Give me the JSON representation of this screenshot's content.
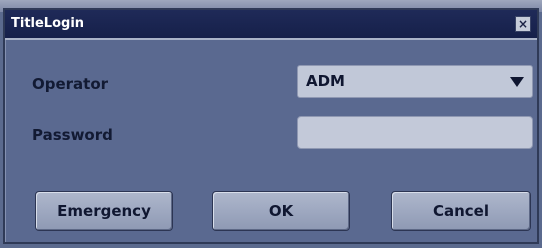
{
  "dialog": {
    "title": "TitleLogin",
    "close_glyph": "×"
  },
  "form": {
    "operator_label": "Operator",
    "operator_value": "ADM",
    "password_label": "Password",
    "password_value": ""
  },
  "buttons": {
    "emergency": "Emergency",
    "ok": "OK",
    "cancel": "Cancel"
  },
  "icons": {
    "close": "close-icon",
    "dropdown": "chevron-down-icon"
  }
}
